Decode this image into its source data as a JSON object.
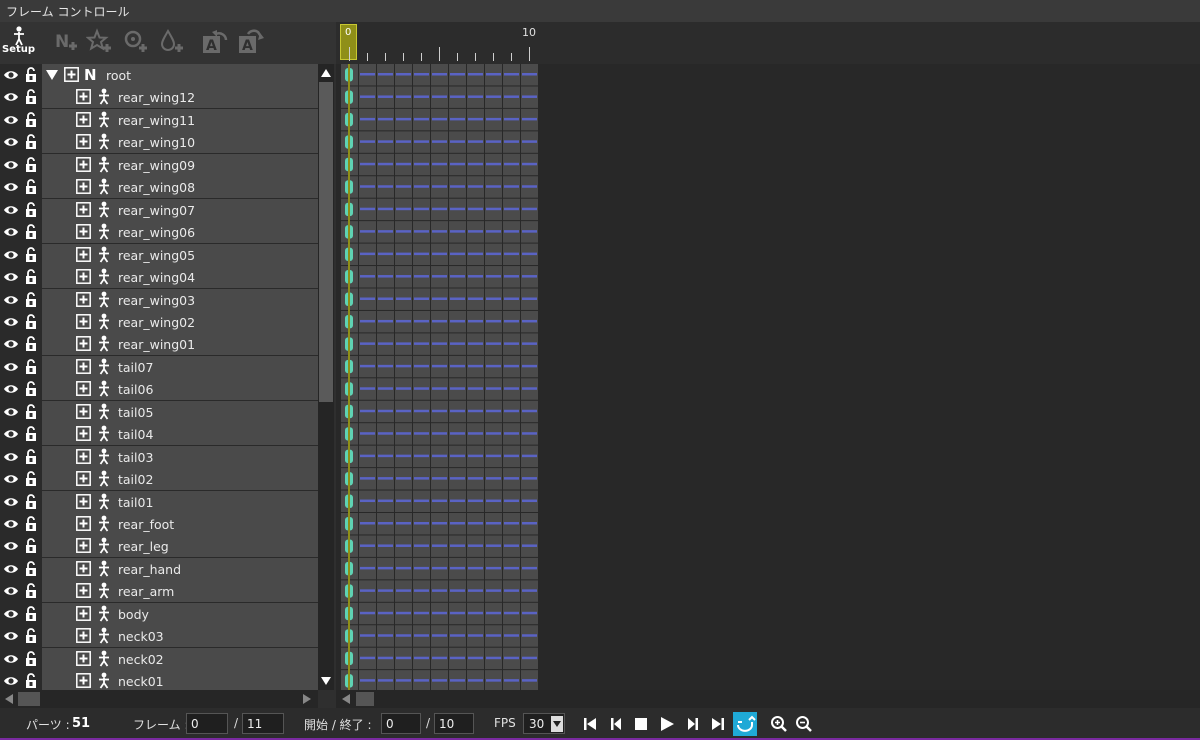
{
  "window": {
    "title": "フレーム コントロール"
  },
  "toolbar": {
    "setup_label": "Setup",
    "buttons": [
      "setup-icon",
      "add-null-icon",
      "add-star-icon",
      "add-effect-icon",
      "add-drop-icon",
      "text-rotate-left-icon",
      "text-rotate-right-icon"
    ]
  },
  "tree": {
    "root": {
      "name": "root"
    },
    "parts": [
      "rear_wing12",
      "rear_wing11",
      "rear_wing10",
      "rear_wing09",
      "rear_wing08",
      "rear_wing07",
      "rear_wing06",
      "rear_wing05",
      "rear_wing04",
      "rear_wing03",
      "rear_wing02",
      "rear_wing01",
      "tail07",
      "tail06",
      "tail05",
      "tail04",
      "tail03",
      "tail02",
      "tail01",
      "rear_foot",
      "rear_leg",
      "rear_hand",
      "rear_arm",
      "body",
      "neck03",
      "neck02",
      "neck01"
    ]
  },
  "timeline": {
    "current_frame_label": "0",
    "ruler_label_10": "10",
    "frames": 11
  },
  "bottom": {
    "parts_label": "パーツ :",
    "parts_count": "51",
    "frame_label": "フレーム :",
    "frame_value": "0",
    "frame_total": "11",
    "range_label": "開始 / 終了 :",
    "range_start": "0",
    "range_end": "10",
    "fps_label": "FPS",
    "fps_value": "30",
    "slash": "/"
  },
  "colors": {
    "keyframe": "#5fd3b4",
    "tween": "#5a63c4",
    "cursor": "#8f8f18",
    "loop_active": "#1fa9d6"
  }
}
